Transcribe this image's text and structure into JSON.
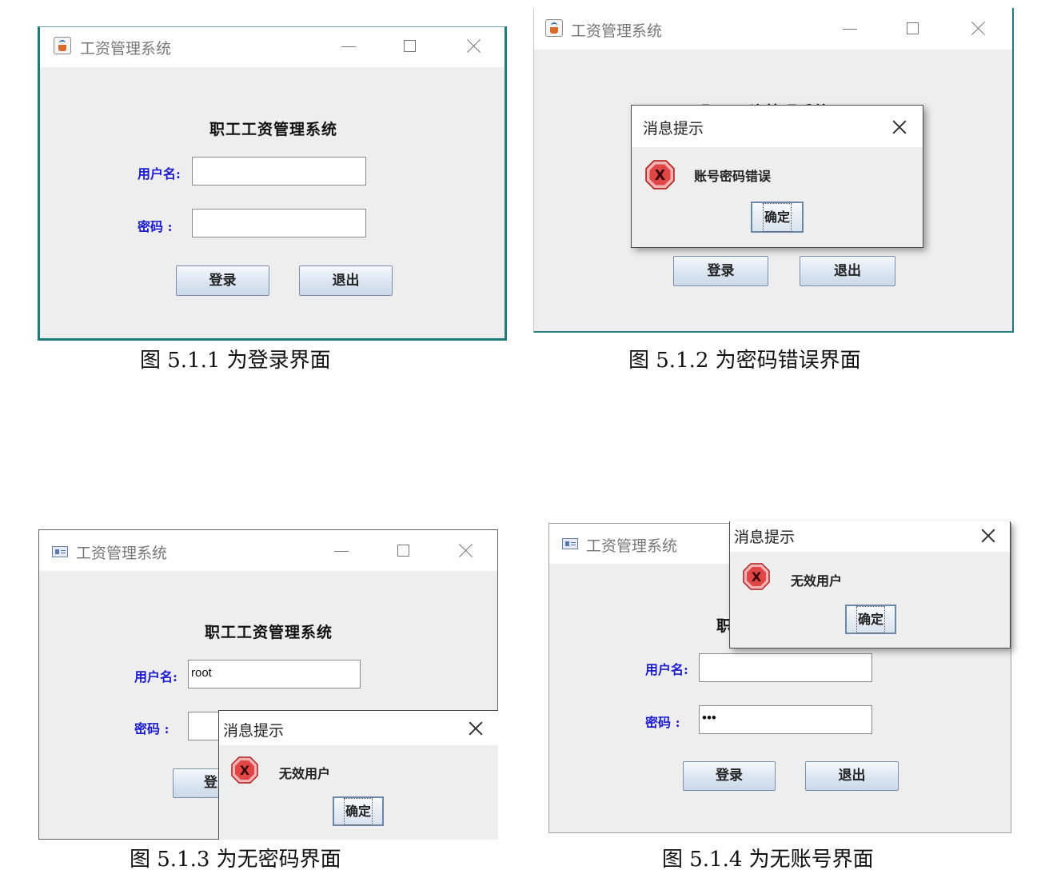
{
  "window_title": "工资管理系统",
  "system_heading": "职工工资管理系统",
  "labels": {
    "username": "用户名:",
    "password": "密码 :"
  },
  "buttons": {
    "login": "登录",
    "exit": "退出",
    "ok": "确定"
  },
  "dialog_title": "消息提示",
  "panels": [
    {
      "caption": "图 5.1.1  为登录界面",
      "username_value": "",
      "password_value": ""
    },
    {
      "caption": "图 5.1.2  为密码错误界面",
      "dialog_message": "账号密码错误",
      "partial_heading": "职工工资管理系统"
    },
    {
      "caption": "图 5.1.3  为无密码界面",
      "username_value": "root",
      "password_value": "",
      "dialog_message": "无效用户",
      "partial_button": "登"
    },
    {
      "caption": "图 5.1.4  为无账号界面",
      "username_value": "",
      "password_value": "•••",
      "dialog_message": "无效用户",
      "partial_heading": "职"
    }
  ],
  "colors": {
    "label_blue": "#1a1ad0",
    "window_bg": "#eeeeee",
    "border_teal": "#207a7a",
    "error_red": "#d9252a"
  }
}
